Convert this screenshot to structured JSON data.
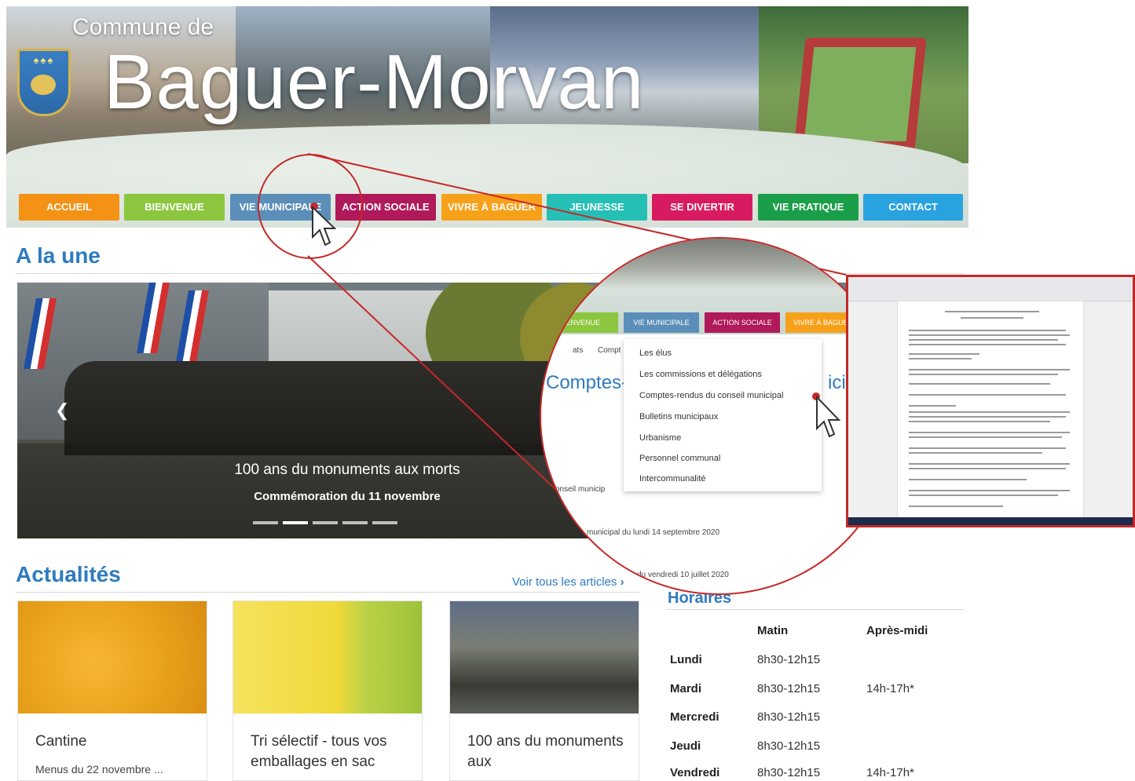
{
  "header": {
    "prefix": "Commune de",
    "city": "Baguer-Morvan"
  },
  "nav": {
    "items": [
      {
        "label": "ACCUEIL",
        "color": "#f39214"
      },
      {
        "label": "BIENVENUE",
        "color": "#8cc63f"
      },
      {
        "label": "VIE MUNICIPALE",
        "color": "#5b8fb9"
      },
      {
        "label": "ACTION SOCIALE",
        "color": "#b0195a"
      },
      {
        "label": "VIVRE À BAGUER",
        "color": "#f7a11a"
      },
      {
        "label": "JEUNESSE",
        "color": "#26bfb5"
      },
      {
        "label": "SE DIVERTIR",
        "color": "#d81b60"
      },
      {
        "label": "VIE PRATIQUE",
        "color": "#1b9e49"
      },
      {
        "label": "CONTACT",
        "color": "#29a3e0"
      }
    ]
  },
  "headline": {
    "title": "A la une",
    "slide_title": "100 ans du monuments aux morts",
    "slide_subtitle": "Commémoration du 11 novembre"
  },
  "news": {
    "title": "Actualités",
    "see_all": "Voir tous les articles",
    "cards": [
      {
        "title": "Cantine",
        "subtitle": "Menus du 22 novembre ..."
      },
      {
        "title": "Tri sélectif - tous vos emballages en sac",
        "subtitle": ""
      },
      {
        "title": "100 ans du monuments aux",
        "subtitle": ""
      }
    ]
  },
  "hours": {
    "title": "Horaires",
    "col_morning": "Matin",
    "col_afternoon": "Après-midi",
    "rows": [
      {
        "day": "Lundi",
        "morning": "8h30-12h15",
        "afternoon": ""
      },
      {
        "day": "Mardi",
        "morning": "8h30-12h15",
        "afternoon": "14h-17h*"
      },
      {
        "day": "Mercredi",
        "morning": "8h30-12h15",
        "afternoon": ""
      },
      {
        "day": "Jeudi",
        "morning": "8h30-12h15",
        "afternoon": ""
      },
      {
        "day": "Vendredi",
        "morning": "8h30-12h15",
        "afternoon": "14h-17h*"
      }
    ]
  },
  "zoom": {
    "nav_labels": [
      "BIENVENUE",
      "VIE MUNICIPALE",
      "ACTION SOCIALE",
      "VIVRE À BAGUER"
    ],
    "menu": [
      "Les élus",
      "Les commissions et délégations",
      "Comptes-rendus du conseil municipal",
      "Bulletins municipaux",
      "Urbanisme",
      "Personnel communal",
      "Intercommunalité"
    ],
    "heading": "Comptes-",
    "heading_end": "icip",
    "breadcrumb": "Compt",
    "breadcrumb_start": "ats",
    "text1": "onseil municip",
    "text2": "municipal du lundi 14 septembre 2020",
    "text3": "du vendredi 10 juillet 2020"
  }
}
